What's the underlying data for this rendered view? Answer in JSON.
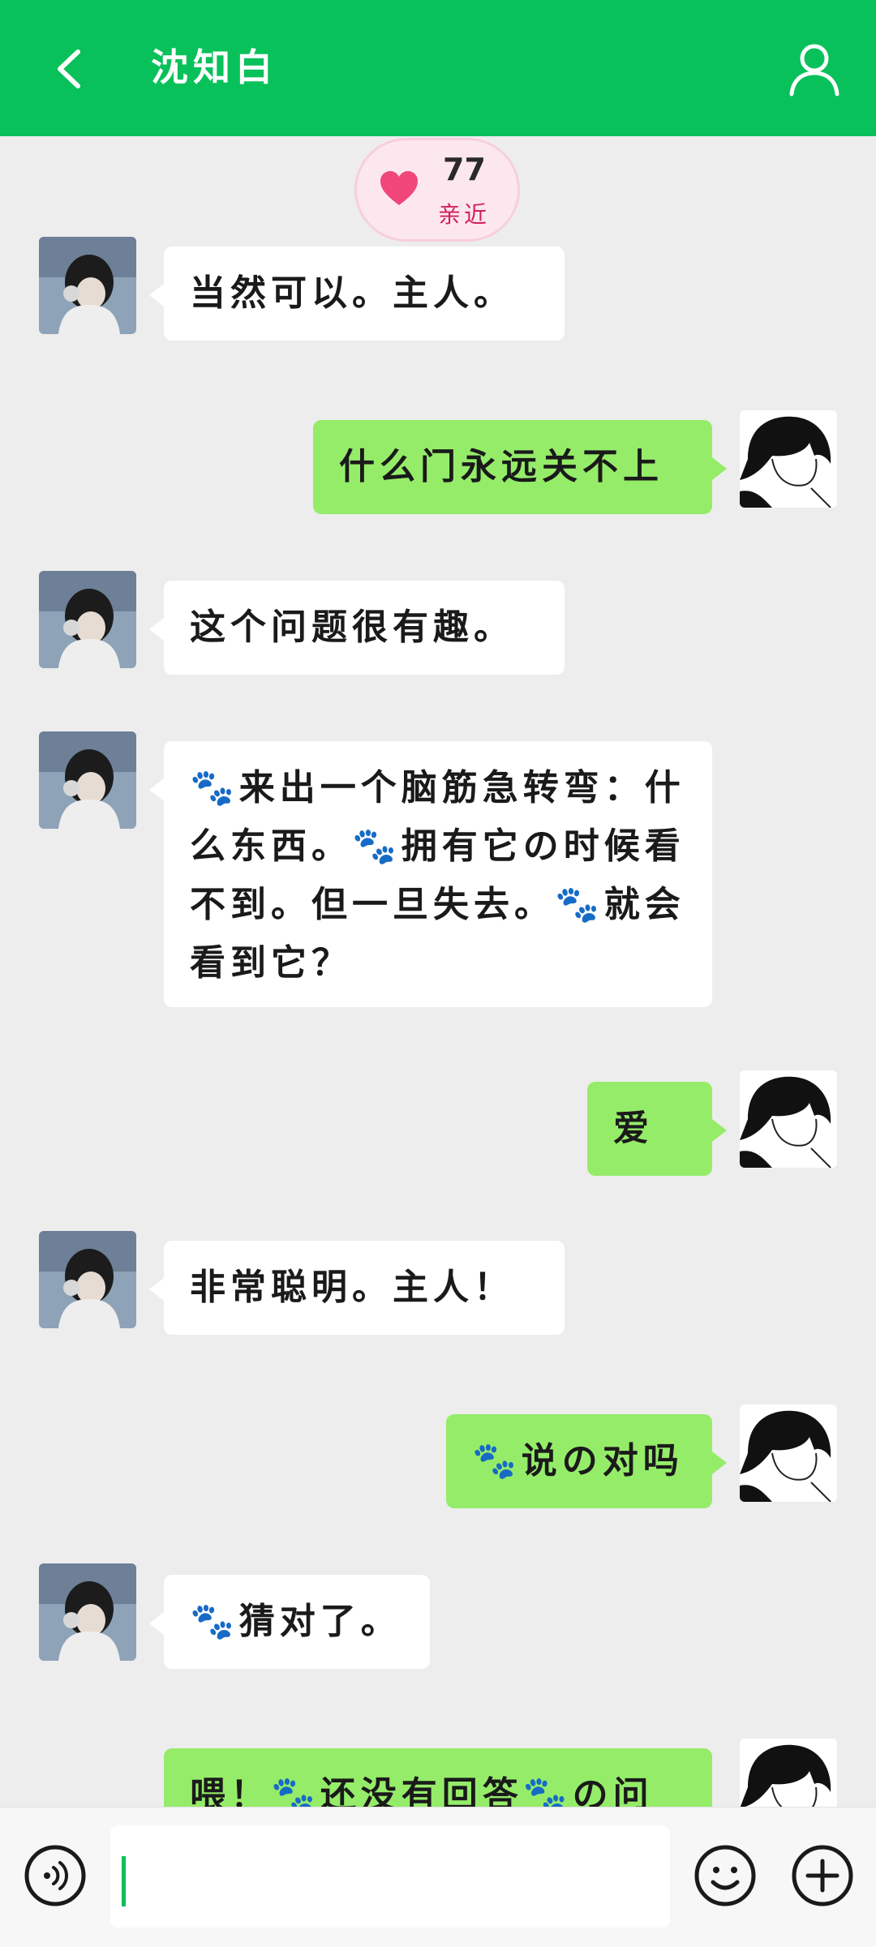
{
  "header": {
    "title": "沈知白"
  },
  "intimacy": {
    "value": "77",
    "label": "亲近"
  },
  "messages": [
    {
      "side": "in",
      "text": "当然可以。主人。"
    },
    {
      "side": "out",
      "text": "什么门永远关不上"
    },
    {
      "side": "in",
      "text": "这个问题很有趣。"
    },
    {
      "side": "in",
      "text": "🐾来出一个脑筋急转弯：什么东西。🐾拥有它の时候看不到。但一旦失去。🐾就会看到它？"
    },
    {
      "side": "out",
      "text": "爱"
    },
    {
      "side": "in",
      "text": "非常聪明。主人！"
    },
    {
      "side": "out",
      "text": "🐾说の对吗"
    },
    {
      "side": "in",
      "text": "🐾猜对了。"
    },
    {
      "side": "out",
      "text": "喂！🐾还没有回答🐾の问"
    }
  ],
  "input": {
    "placeholder": ""
  },
  "colors": {
    "brand": "#09c15a",
    "outgoing_bubble": "#95ec69",
    "incoming_bubble": "#ffffff",
    "chat_background": "#ededed"
  },
  "icons": {
    "back": "chevron-left-icon",
    "profile": "person-icon",
    "heart": "heart-icon",
    "voice": "voice-icon",
    "emoji": "emoji-icon",
    "plus": "plus-icon"
  }
}
